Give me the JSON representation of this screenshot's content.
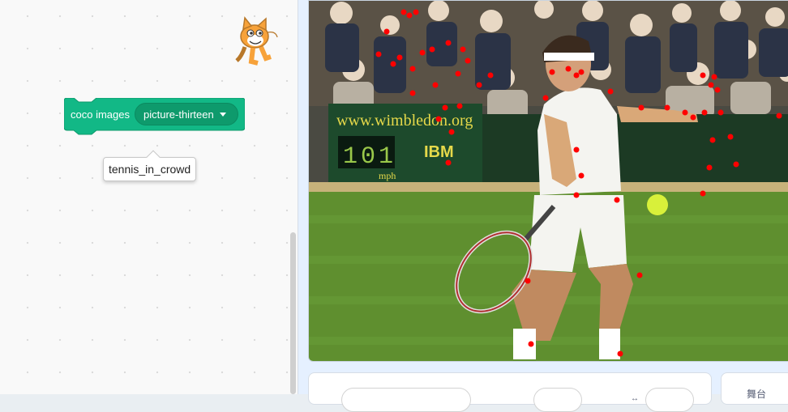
{
  "block": {
    "label": "coco images",
    "dropdown_value": "picture-thirteen",
    "color": "#12b886"
  },
  "tooltip": {
    "text": "tennis_in_crowd"
  },
  "stage": {
    "banner_url_text": "www.wimbledon.org",
    "scoreboard_value": "101",
    "scoreboard_unit": "mph",
    "sponsor_text": "IBM",
    "keypoint_color": "#ff0000"
  },
  "stage_panel": {
    "label": "舞台"
  },
  "sprite_info": {
    "mark": "↔"
  },
  "icons": [
    "scratch-cat-icon",
    "dropdown-arrow-icon"
  ]
}
